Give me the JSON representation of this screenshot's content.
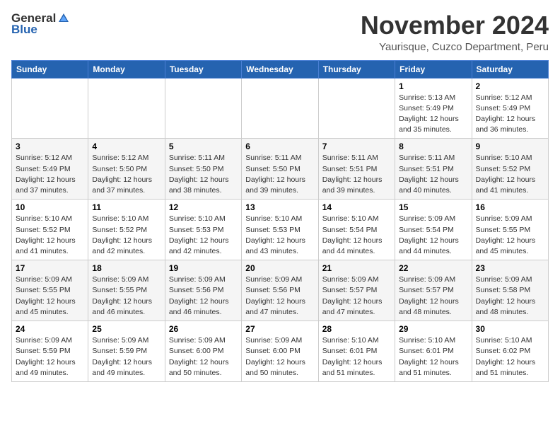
{
  "header": {
    "logo_general": "General",
    "logo_blue": "Blue",
    "month_title": "November 2024",
    "location": "Yaurisque, Cuzco Department, Peru"
  },
  "calendar": {
    "days_of_week": [
      "Sunday",
      "Monday",
      "Tuesday",
      "Wednesday",
      "Thursday",
      "Friday",
      "Saturday"
    ],
    "weeks": [
      [
        {
          "day": "",
          "info": ""
        },
        {
          "day": "",
          "info": ""
        },
        {
          "day": "",
          "info": ""
        },
        {
          "day": "",
          "info": ""
        },
        {
          "day": "",
          "info": ""
        },
        {
          "day": "1",
          "info": "Sunrise: 5:13 AM\nSunset: 5:49 PM\nDaylight: 12 hours\nand 35 minutes."
        },
        {
          "day": "2",
          "info": "Sunrise: 5:12 AM\nSunset: 5:49 PM\nDaylight: 12 hours\nand 36 minutes."
        }
      ],
      [
        {
          "day": "3",
          "info": "Sunrise: 5:12 AM\nSunset: 5:49 PM\nDaylight: 12 hours\nand 37 minutes."
        },
        {
          "day": "4",
          "info": "Sunrise: 5:12 AM\nSunset: 5:50 PM\nDaylight: 12 hours\nand 37 minutes."
        },
        {
          "day": "5",
          "info": "Sunrise: 5:11 AM\nSunset: 5:50 PM\nDaylight: 12 hours\nand 38 minutes."
        },
        {
          "day": "6",
          "info": "Sunrise: 5:11 AM\nSunset: 5:50 PM\nDaylight: 12 hours\nand 39 minutes."
        },
        {
          "day": "7",
          "info": "Sunrise: 5:11 AM\nSunset: 5:51 PM\nDaylight: 12 hours\nand 39 minutes."
        },
        {
          "day": "8",
          "info": "Sunrise: 5:11 AM\nSunset: 5:51 PM\nDaylight: 12 hours\nand 40 minutes."
        },
        {
          "day": "9",
          "info": "Sunrise: 5:10 AM\nSunset: 5:52 PM\nDaylight: 12 hours\nand 41 minutes."
        }
      ],
      [
        {
          "day": "10",
          "info": "Sunrise: 5:10 AM\nSunset: 5:52 PM\nDaylight: 12 hours\nand 41 minutes."
        },
        {
          "day": "11",
          "info": "Sunrise: 5:10 AM\nSunset: 5:52 PM\nDaylight: 12 hours\nand 42 minutes."
        },
        {
          "day": "12",
          "info": "Sunrise: 5:10 AM\nSunset: 5:53 PM\nDaylight: 12 hours\nand 42 minutes."
        },
        {
          "day": "13",
          "info": "Sunrise: 5:10 AM\nSunset: 5:53 PM\nDaylight: 12 hours\nand 43 minutes."
        },
        {
          "day": "14",
          "info": "Sunrise: 5:10 AM\nSunset: 5:54 PM\nDaylight: 12 hours\nand 44 minutes."
        },
        {
          "day": "15",
          "info": "Sunrise: 5:09 AM\nSunset: 5:54 PM\nDaylight: 12 hours\nand 44 minutes."
        },
        {
          "day": "16",
          "info": "Sunrise: 5:09 AM\nSunset: 5:55 PM\nDaylight: 12 hours\nand 45 minutes."
        }
      ],
      [
        {
          "day": "17",
          "info": "Sunrise: 5:09 AM\nSunset: 5:55 PM\nDaylight: 12 hours\nand 45 minutes."
        },
        {
          "day": "18",
          "info": "Sunrise: 5:09 AM\nSunset: 5:55 PM\nDaylight: 12 hours\nand 46 minutes."
        },
        {
          "day": "19",
          "info": "Sunrise: 5:09 AM\nSunset: 5:56 PM\nDaylight: 12 hours\nand 46 minutes."
        },
        {
          "day": "20",
          "info": "Sunrise: 5:09 AM\nSunset: 5:56 PM\nDaylight: 12 hours\nand 47 minutes."
        },
        {
          "day": "21",
          "info": "Sunrise: 5:09 AM\nSunset: 5:57 PM\nDaylight: 12 hours\nand 47 minutes."
        },
        {
          "day": "22",
          "info": "Sunrise: 5:09 AM\nSunset: 5:57 PM\nDaylight: 12 hours\nand 48 minutes."
        },
        {
          "day": "23",
          "info": "Sunrise: 5:09 AM\nSunset: 5:58 PM\nDaylight: 12 hours\nand 48 minutes."
        }
      ],
      [
        {
          "day": "24",
          "info": "Sunrise: 5:09 AM\nSunset: 5:59 PM\nDaylight: 12 hours\nand 49 minutes."
        },
        {
          "day": "25",
          "info": "Sunrise: 5:09 AM\nSunset: 5:59 PM\nDaylight: 12 hours\nand 49 minutes."
        },
        {
          "day": "26",
          "info": "Sunrise: 5:09 AM\nSunset: 6:00 PM\nDaylight: 12 hours\nand 50 minutes."
        },
        {
          "day": "27",
          "info": "Sunrise: 5:09 AM\nSunset: 6:00 PM\nDaylight: 12 hours\nand 50 minutes."
        },
        {
          "day": "28",
          "info": "Sunrise: 5:10 AM\nSunset: 6:01 PM\nDaylight: 12 hours\nand 51 minutes."
        },
        {
          "day": "29",
          "info": "Sunrise: 5:10 AM\nSunset: 6:01 PM\nDaylight: 12 hours\nand 51 minutes."
        },
        {
          "day": "30",
          "info": "Sunrise: 5:10 AM\nSunset: 6:02 PM\nDaylight: 12 hours\nand 51 minutes."
        }
      ]
    ]
  }
}
